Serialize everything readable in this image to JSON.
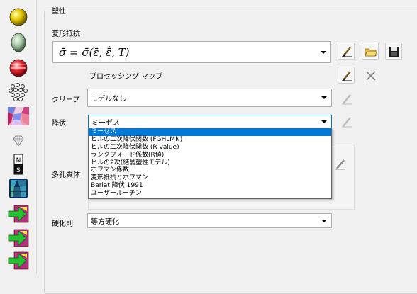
{
  "group": {
    "title": "塑性"
  },
  "deformation": {
    "label": "変形抵抗",
    "formula": "σ̄ = σ̄(ε̄, ε̄̇, T)"
  },
  "processing_map": {
    "label": "プロセッシング マップ"
  },
  "creep": {
    "label": "クリープ",
    "value": "モデルなし"
  },
  "yield": {
    "label": "降伏",
    "value": "ミーゼス",
    "options": [
      "ミーゼス",
      "ヒルの二次降伏関数 (FGHLMN)",
      "ヒルの二次降伏関数 (R value)",
      "ランクフォード係数(R値)",
      "ヒルの2次(結晶塑性モデル)",
      "ホフマン係数",
      "変形抵抗とホフマン",
      "Barlat 降伏 1991",
      "ユーザールーチン"
    ],
    "selected_index": 0
  },
  "porous": {
    "label": "多孔質体"
  },
  "hardening": {
    "label": "硬化則",
    "value": "等方硬化"
  },
  "toolbar_icons": [
    "yellow-sphere-icon",
    "green-sphere-icon",
    "red-sphere-icon",
    "particles-icon",
    "texture-icon",
    "diamond-icon",
    "magnet-icon",
    "grain-icon",
    "arrow-in-icon-1",
    "arrow-in-icon-2",
    "arrow-in-icon-3"
  ],
  "colors": {
    "accent": "#0078d7",
    "dialog_bg": "#f0f0f0"
  }
}
